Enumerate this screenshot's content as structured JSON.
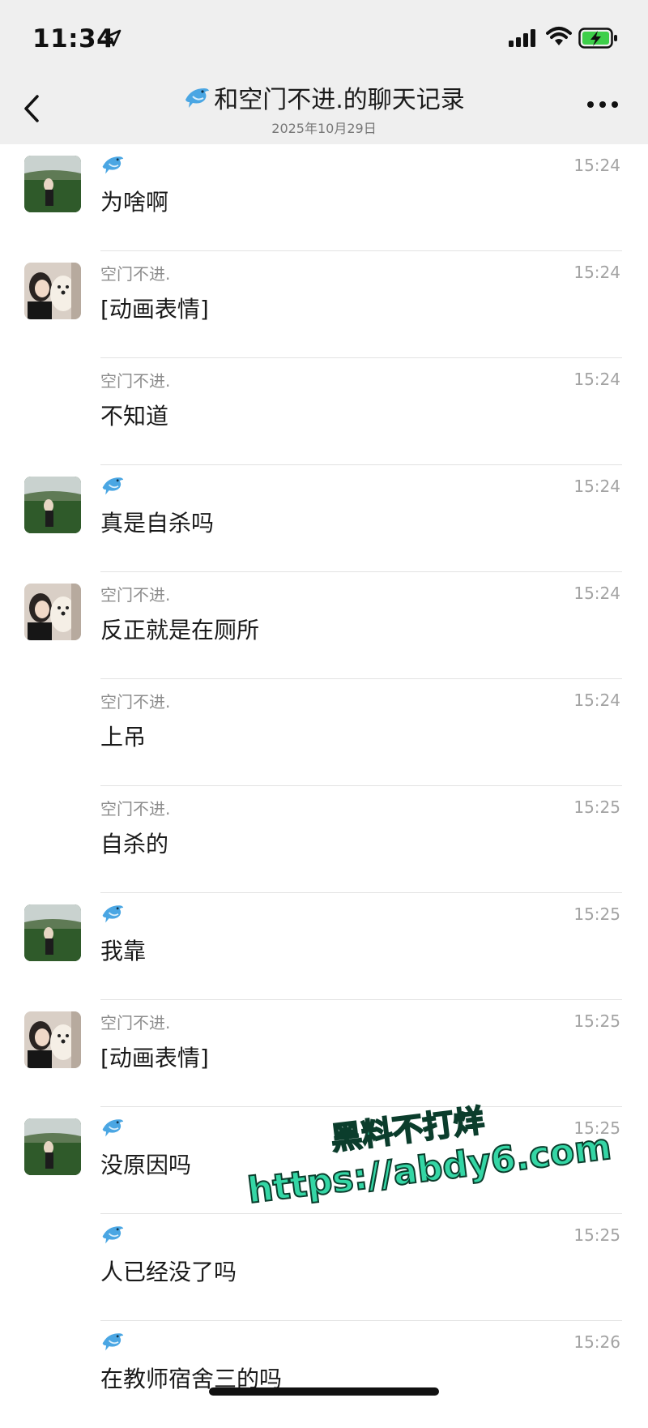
{
  "status_bar": {
    "time": "11:34"
  },
  "header": {
    "title": "和空门不进.的聊天记录",
    "date": "2025年10月29日"
  },
  "messages": [
    {
      "sender_type": "self",
      "sender": "",
      "time": "15:24",
      "text": "为啥啊",
      "avatar": "landscape-avatar"
    },
    {
      "sender_type": "other",
      "sender": "空门不进.",
      "time": "15:24",
      "text": "[动画表情]",
      "avatar": "girl-dog-avatar"
    },
    {
      "sender_type": "other",
      "sender": "空门不进.",
      "time": "15:24",
      "text": "不知道",
      "avatar": ""
    },
    {
      "sender_type": "self",
      "sender": "",
      "time": "15:24",
      "text": "真是自杀吗",
      "avatar": "landscape-avatar"
    },
    {
      "sender_type": "other",
      "sender": "空门不进.",
      "time": "15:24",
      "text": "反正就是在厕所",
      "avatar": "girl-dog-avatar"
    },
    {
      "sender_type": "other",
      "sender": "空门不进.",
      "time": "15:24",
      "text": "上吊",
      "avatar": ""
    },
    {
      "sender_type": "other",
      "sender": "空门不进.",
      "time": "15:25",
      "text": "自杀的",
      "avatar": ""
    },
    {
      "sender_type": "self",
      "sender": "",
      "time": "15:25",
      "text": "我靠",
      "avatar": "landscape-avatar"
    },
    {
      "sender_type": "other",
      "sender": "空门不进.",
      "time": "15:25",
      "text": "[动画表情]",
      "avatar": "girl-dog-avatar"
    },
    {
      "sender_type": "self",
      "sender": "",
      "time": "15:25",
      "text": "没原因吗",
      "avatar": "landscape-avatar"
    },
    {
      "sender_type": "self",
      "sender": "",
      "time": "15:25",
      "text": "人已经没了吗",
      "avatar": ""
    },
    {
      "sender_type": "self",
      "sender": "",
      "time": "15:26",
      "text": "在教师宿舍三的吗",
      "avatar": ""
    }
  ],
  "watermark": {
    "line1": "黑料不打烊",
    "line2": "https://abdy6.com"
  },
  "colors": {
    "header_bg": "#efefef",
    "watermark": "#34d6a5"
  }
}
